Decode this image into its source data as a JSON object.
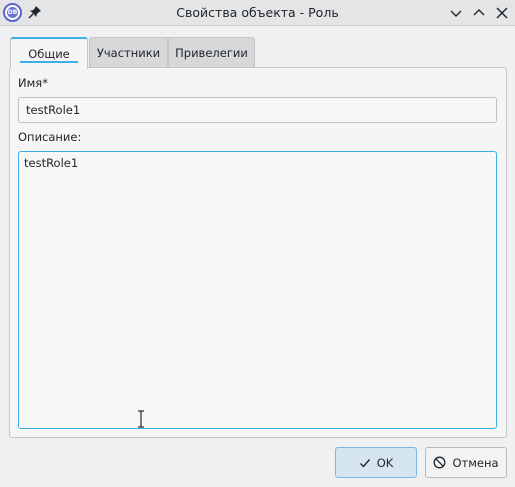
{
  "window": {
    "title": "Свойства объекта - Роль",
    "app_icon_text": "DB"
  },
  "tabs": [
    {
      "label": "Общие",
      "active": true
    },
    {
      "label": "Участники",
      "active": false
    },
    {
      "label": "Привелегии",
      "active": false
    }
  ],
  "form": {
    "name_label": "Имя*",
    "name_value": "testRole1",
    "description_label": "Описание:",
    "description_value": "testRole1"
  },
  "buttons": {
    "ok_label": "OK",
    "cancel_label": "Отмена"
  },
  "colors": {
    "accent": "#3daee9",
    "app_icon": "#5a66c7"
  },
  "icons": [
    "app-icon",
    "pin-icon",
    "minimize-icon",
    "maximize-icon",
    "close-icon",
    "checkmark-icon",
    "cancel-icon",
    "text-cursor-icon"
  ]
}
